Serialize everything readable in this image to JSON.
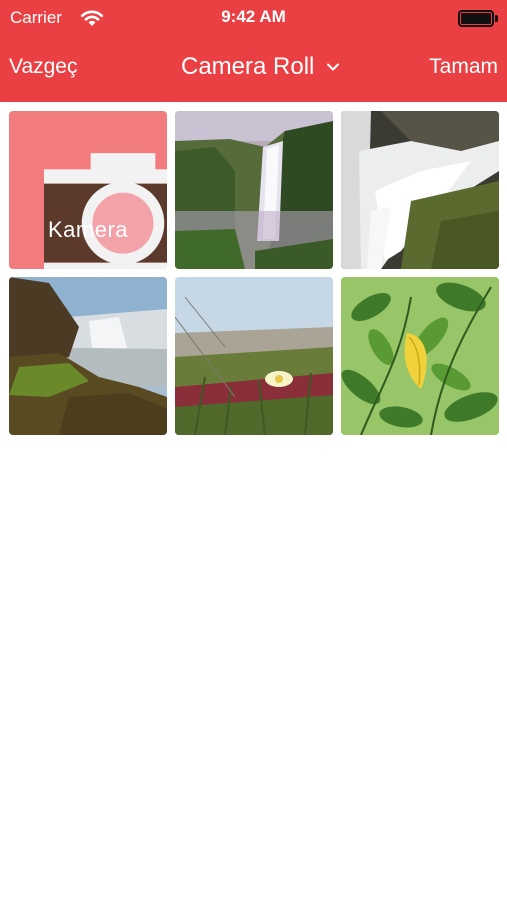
{
  "status_bar": {
    "carrier": "Carrier",
    "time": "9:42 AM"
  },
  "nav": {
    "cancel_label": "Vazgeç",
    "title": "Camera Roll",
    "done_label": "Tamam"
  },
  "grid": {
    "camera_label": "Kamera",
    "photos": [
      {
        "name": "waterfall-cliff-photo"
      },
      {
        "name": "waterfall-closeup-photo"
      },
      {
        "name": "waterfall-shore-photo"
      },
      {
        "name": "flower-field-photo"
      },
      {
        "name": "green-leaves-photo"
      }
    ]
  },
  "colors": {
    "accent": "#ea4043",
    "camera_tile": "#f27b7d"
  }
}
